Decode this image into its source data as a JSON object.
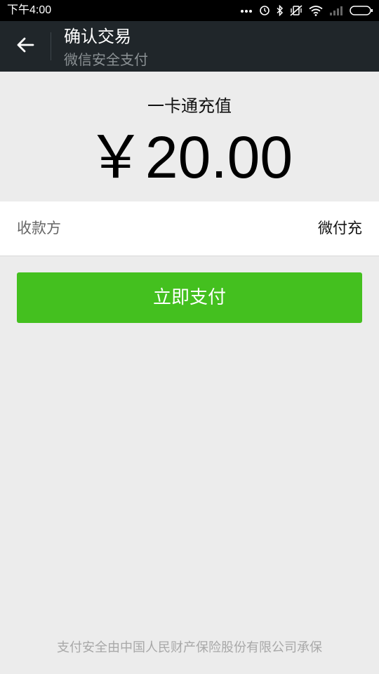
{
  "status_bar": {
    "time": "下午4:00",
    "icons": [
      "more-dots-icon",
      "alarm-icon",
      "bluetooth-icon",
      "silent-vibrate-icon",
      "wifi-icon",
      "cellular-signal-icon",
      "battery-icon"
    ]
  },
  "header": {
    "title": "确认交易",
    "subtitle": "微信安全支付",
    "back_icon": "back-arrow-icon"
  },
  "order": {
    "product": "一卡通充值",
    "amount": "￥20.00"
  },
  "payee": {
    "label": "收款方",
    "value": "微付充"
  },
  "actions": {
    "pay_label": "立即支付"
  },
  "footer": {
    "note": "支付安全由中国人民财产保险股份有限公司承保"
  },
  "colors": {
    "header_bg": "#20262a",
    "page_bg": "#ececec",
    "pay_button": "#44c01f"
  }
}
